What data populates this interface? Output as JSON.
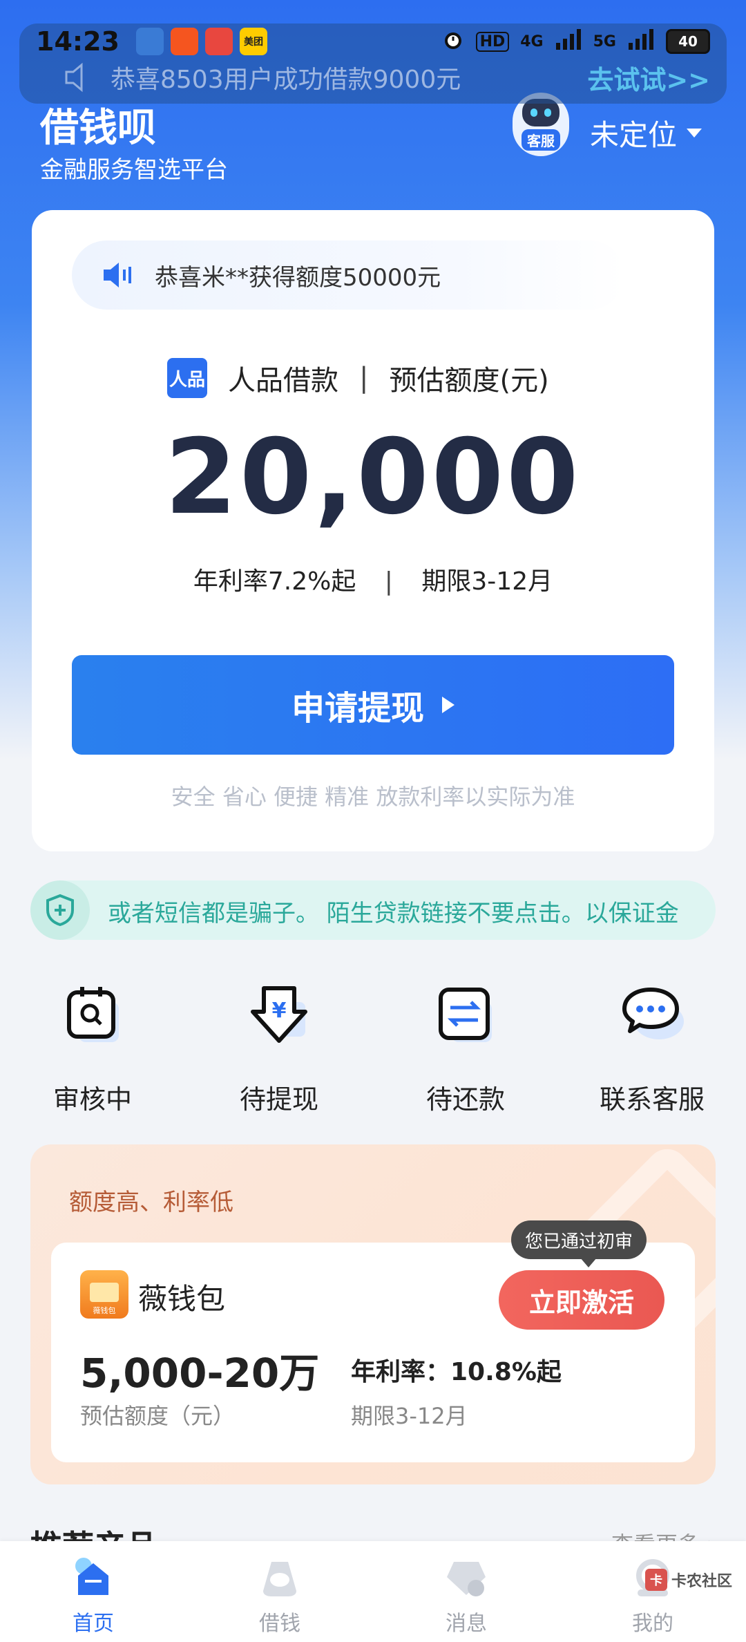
{
  "status_bar": {
    "time": "14:23",
    "apps": [
      {
        "name": "app-icon-1",
        "color": "#3a7bd5",
        "text": ""
      },
      {
        "name": "app-icon-2",
        "color": "#f5551f",
        "text": ""
      },
      {
        "name": "app-icon-3",
        "color": "#e8473f",
        "text": ""
      },
      {
        "name": "meituan-icon",
        "color": "#ffcc00",
        "text": "美团"
      }
    ],
    "hd": "HD",
    "net1": "4G",
    "net2": "5G",
    "battery": "40"
  },
  "toast": {
    "text": "恭喜8503用户成功借款9000元",
    "action": "去试试>>"
  },
  "header": {
    "brand": "借钱呗",
    "subtitle": "金融服务智选平台",
    "service_label": "客服",
    "location": "未定位"
  },
  "main_card": {
    "notice": "恭喜米**获得额度50000元",
    "badge": "人品",
    "product_name": "人品借款",
    "separator": "|",
    "amount_label": "预估额度(元)",
    "amount": "20,000",
    "rate": "年利率7.2%起",
    "term": "期限3-12月",
    "apply_label": "申请提现",
    "safety_note": "安全 省心 便捷 精准 放款利率以实际为准"
  },
  "warning": {
    "text": "或者短信都是骗子。 陌生贷款链接不要点击。以保证金"
  },
  "quick_actions": [
    {
      "label": "审核中",
      "icon": "review-icon"
    },
    {
      "label": "待提现",
      "icon": "withdraw-icon"
    },
    {
      "label": "待还款",
      "icon": "repay-icon"
    },
    {
      "label": "联系客服",
      "icon": "chat-icon"
    }
  ],
  "promo": {
    "tagline": "额度高、利率低",
    "logo_label": "薇钱包",
    "name": "薇钱包",
    "review_badge": "您已通过初审",
    "activate_label": "立即激活",
    "amount": "5,000-20万",
    "amount_label": "预估额度（元）",
    "rate": "年利率：10.8%起",
    "term": "期限3-12月"
  },
  "section": {
    "title": "推荐产品",
    "more": "查看更多 ›"
  },
  "bottom_nav": [
    {
      "label": "首页",
      "icon": "home-icon",
      "active": true
    },
    {
      "label": "借钱",
      "icon": "borrow-icon",
      "active": false
    },
    {
      "label": "消息",
      "icon": "message-icon",
      "active": false
    },
    {
      "label": "我的",
      "icon": "profile-icon",
      "active": false
    }
  ],
  "watermark": {
    "mark": "卡",
    "text": "卡农社区"
  },
  "colors": {
    "primary": "#2c6ff0",
    "amount_text": "#232c45",
    "activate": "#ea5852",
    "warning_text": "#2aa89a"
  }
}
